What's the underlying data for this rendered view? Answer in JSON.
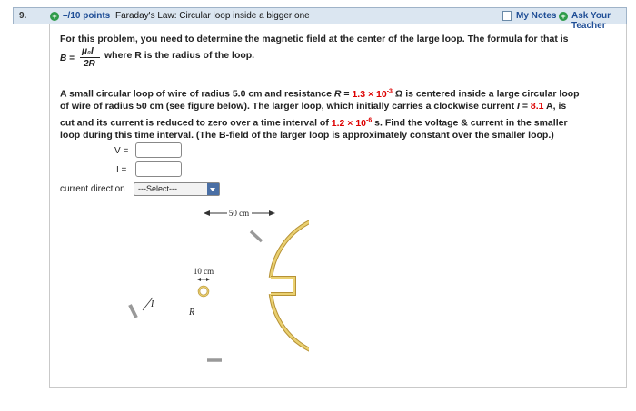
{
  "question": {
    "number": "9.",
    "points": "–/10 points",
    "title": "Faraday's Law: Circular loop inside a bigger one",
    "my_notes": "My Notes",
    "ask_teacher": "Ask Your Teacher"
  },
  "intro": {
    "line1": "For this problem, you need to determine the magnetic field at the center of the large loop. The formula for that is",
    "formula_lhs": "B =",
    "formula_num": "μ₀I",
    "formula_den": "2R",
    "formula_tail": "where R is the radius of the loop."
  },
  "problem": {
    "l1a": "A small circular loop of wire of radius 5.0 cm and resistance ",
    "l1b": "R",
    "l1c": " = ",
    "R_value": "1.3 × 10",
    "R_exp": "-3",
    "l1d": " Ω is centered inside a large circular loop",
    "l2a": "of wire of radius 50 cm (see figure below). The larger loop, which initially carries a clockwise current ",
    "l2b": "I",
    "l2c": " = ",
    "I_value": "8.1",
    "l2d": " A, is",
    "l3a": "cut and its current is reduced to zero over a time interval of ",
    "t_value": "1.2 × 10",
    "t_exp": "-6",
    "l3b": " s. Find the voltage & current in the smaller",
    "l4": "loop during this time interval. (The B-field of the larger loop is approximately constant over the smaller loop.)"
  },
  "answers": {
    "v_label": "V =",
    "i_label": "I =",
    "v_value": "",
    "i_value": "",
    "direction_label": "current direction",
    "direction_selected": "---Select---"
  },
  "figure": {
    "large_label": "50 cm",
    "small_label": "10 cm",
    "current_label": "I",
    "resistance_label": "R"
  },
  "colors": {
    "header_bg": "#dbe6f1",
    "link": "#1f4e96",
    "value_red": "#dd0000",
    "loop": "#e8c65c",
    "plus_green": "#2e9b4a"
  }
}
